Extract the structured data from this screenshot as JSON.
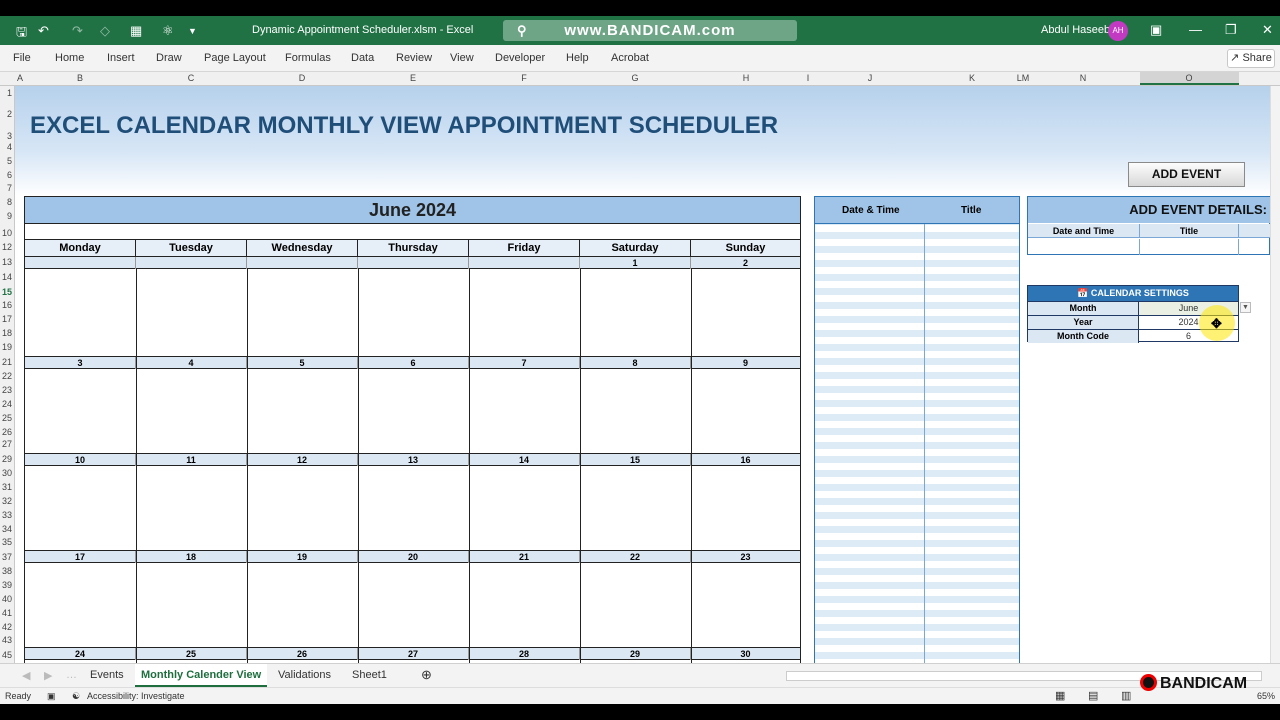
{
  "window": {
    "title": "Dynamic Appointment Scheduler.xlsm  -  Excel",
    "recorder_url": "www.BANDICAM.com",
    "user_name": "Abdul Haseeb",
    "user_initials": "AH"
  },
  "ribbon": {
    "tabs": [
      "File",
      "Home",
      "Insert",
      "Draw",
      "Page Layout",
      "Formulas",
      "Data",
      "Review",
      "View",
      "Developer",
      "Help",
      "Acrobat"
    ],
    "share_label": "Share"
  },
  "columns": [
    "A",
    "B",
    "C",
    "D",
    "E",
    "F",
    "G",
    "H",
    "I",
    "J",
    "K",
    "LM",
    "N",
    "O"
  ],
  "rows": [
    "1",
    "2",
    "3",
    "4",
    "5",
    "6",
    "7",
    "8",
    "9",
    "10",
    "12",
    "13",
    "14",
    "15",
    "16",
    "17",
    "18",
    "19",
    "21",
    "22",
    "23",
    "24",
    "25",
    "26",
    "27",
    "29",
    "30",
    "31",
    "32",
    "33",
    "34",
    "35",
    "37",
    "38",
    "39",
    "40",
    "41",
    "42",
    "43",
    "45"
  ],
  "sheet": {
    "title": "EXCEL CALENDAR MONTHLY VIEW APPOINTMENT SCHEDULER",
    "add_event_button": "ADD EVENT"
  },
  "calendar": {
    "month_label": "June 2024",
    "day_names": [
      "Monday",
      "Tuesday",
      "Wednesday",
      "Thursday",
      "Friday",
      "Saturday",
      "Sunday"
    ],
    "weeks": [
      [
        "",
        "",
        "",
        "",
        "",
        "1",
        "2"
      ],
      [
        "3",
        "4",
        "5",
        "6",
        "7",
        "8",
        "9"
      ],
      [
        "10",
        "11",
        "12",
        "13",
        "14",
        "15",
        "16"
      ],
      [
        "17",
        "18",
        "19",
        "20",
        "21",
        "22",
        "23"
      ],
      [
        "24",
        "25",
        "26",
        "27",
        "28",
        "29",
        "30"
      ]
    ]
  },
  "events_panel": {
    "col1": "Date & Time",
    "col2": "Title"
  },
  "event_details": {
    "title": "ADD EVENT DETAILS:",
    "col1": "Date and Time",
    "col2": "Title"
  },
  "settings": {
    "title": "CALENDAR SETTINGS",
    "rows": [
      {
        "label": "Month",
        "value": "June"
      },
      {
        "label": "Year",
        "value": "2024"
      },
      {
        "label": "Month Code",
        "value": "6"
      }
    ]
  },
  "sheet_tabs": [
    "Events",
    "Monthly Calender View",
    "Validations",
    "Sheet1"
  ],
  "active_sheet": "Monthly Calender View",
  "status": {
    "ready": "Ready",
    "accessibility": "Accessibility: Investigate",
    "zoom": "65%"
  },
  "watermark": "BANDICAM"
}
